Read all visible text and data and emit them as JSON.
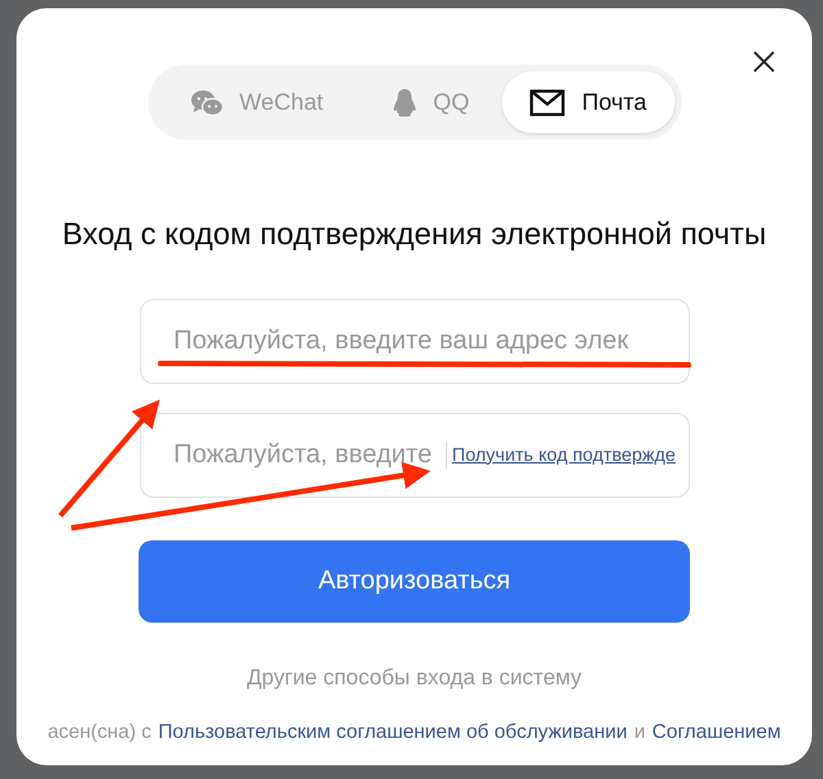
{
  "tabs": [
    {
      "label": "WeChat",
      "kind": "wechat",
      "selected": false
    },
    {
      "label": "QQ",
      "kind": "qq",
      "selected": false
    },
    {
      "label": "Почта",
      "kind": "mail",
      "selected": true
    }
  ],
  "title": "Вход с кодом подтверждения электронной почты",
  "email_field": {
    "placeholder": "Пожалуйста, введите ваш адрес элек"
  },
  "code_field": {
    "placeholder": "Пожалуйста, введите",
    "link": "Получить код подтвержде"
  },
  "submit_button": "Авторизоваться",
  "other_methods": "Другие способы входа в систему",
  "agreement": {
    "text": "асен(сна) с",
    "link_1": "Пользовательским соглашением об обслуживании",
    "conjunction": "и",
    "link_2": "Соглашением"
  }
}
